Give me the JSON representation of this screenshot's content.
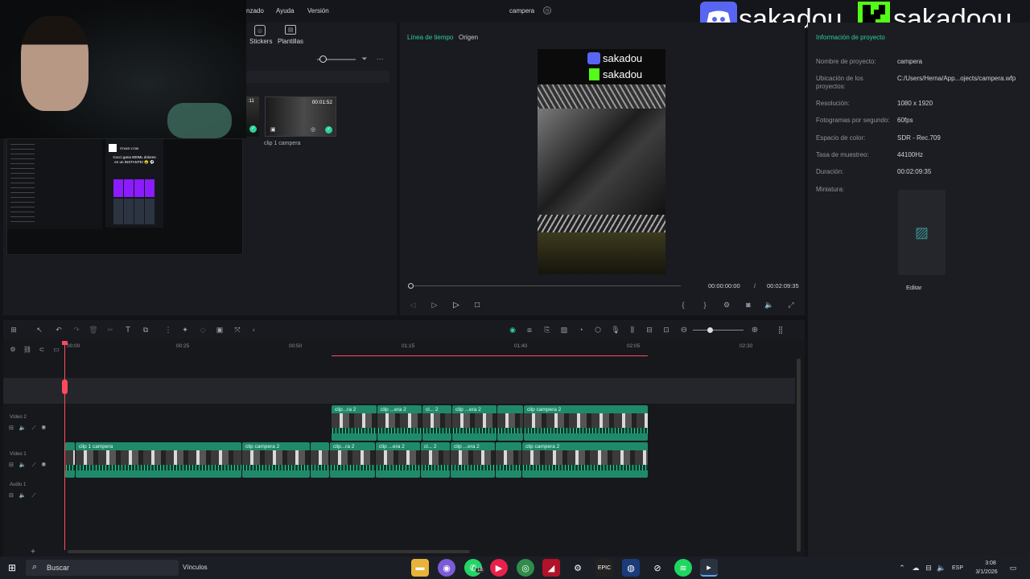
{
  "menu": {
    "items": [
      "nzado",
      "Ayuda",
      "Versión"
    ],
    "project_title": "campera"
  },
  "overlay": {
    "name1": "sakadou",
    "name2": "sakadoou"
  },
  "webcam_stream": {
    "site": "STAKE.COM",
    "promo_line1": "Cocci gana 800ML dolores",
    "promo_line2": "en un INSTANTE! 🤑 ⚽"
  },
  "media": {
    "tabs": [
      "Stickers",
      "Plantillas"
    ],
    "clip_duration": "00:01:52",
    "clip_partial_duration": ":11",
    "clip_name": "clip 1 campera"
  },
  "player": {
    "tab_timeline": "Línea de tiempo",
    "tab_origin": "Origen",
    "watermark1": "sakadou",
    "watermark2": "sakadou",
    "current_time": "00:00:00:00",
    "separator": "/",
    "total_time": "00:02:09:35",
    "progress": 0
  },
  "props": {
    "header": "Información de proyecto",
    "rows": [
      {
        "label": "Nombre de proyecto:",
        "value": "campera"
      },
      {
        "label": "Ubicación de los proyectos:",
        "value": "C:/Users/Herna/App...ojects/campera.wfp"
      },
      {
        "label": "Resolución:",
        "value": "1080 x 1920"
      },
      {
        "label": "Fotogramas por segundo:",
        "value": "60fps"
      },
      {
        "label": "Espacio de color:",
        "value": "SDR - Rec.709"
      },
      {
        "label": "Tasa de muestreo:",
        "value": "44100Hz"
      },
      {
        "label": "Duración:",
        "value": "00:02:09:35"
      },
      {
        "label": "Miniatura:",
        "value": ""
      }
    ],
    "edit_button": "Editar"
  },
  "timeline": {
    "ruler": [
      "00:00",
      "00:25",
      "00:50",
      "01:15",
      "01:40",
      "02:05",
      "02:30"
    ],
    "tracks": {
      "video2": "Vídeo 2",
      "video1": "Vídeo 1",
      "audio1": "Audio 1"
    },
    "video2_clips": [
      "clip...ra 2",
      "clip ...era 2",
      "cl... 2",
      "clip ...era 2",
      "",
      "clip campera 2"
    ],
    "video1_clips": [
      "",
      "clip 1 campera",
      "clip campera 2",
      "",
      "clip...ra 2",
      "clip ...era 2",
      "cl... 2",
      "clip ...era 2",
      "",
      "clip campera 2"
    ]
  },
  "taskbar": {
    "search": "Buscar",
    "links": "Vínculos",
    "whatsapp_badge": "18",
    "lang": "ESP",
    "time": "3:08",
    "date": "3/1/2026"
  },
  "colors": {
    "accent": "#2bd29a",
    "clip": "#1f8a6a",
    "playhead": "#ff4a5e",
    "bg": "#121317"
  }
}
